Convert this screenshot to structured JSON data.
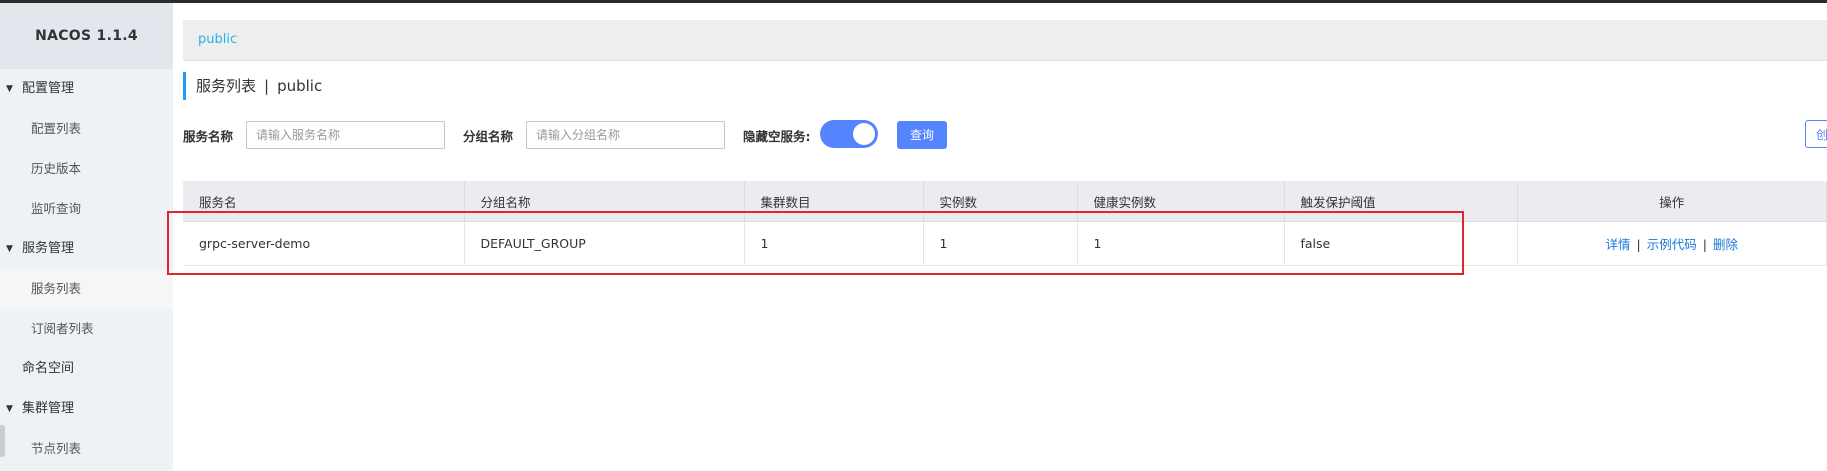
{
  "app": {
    "title": "NACOS 1.1.4"
  },
  "sidebar": {
    "items": [
      {
        "label": "配置管理",
        "type": "group"
      },
      {
        "label": "配置列表",
        "type": "sub"
      },
      {
        "label": "历史版本",
        "type": "sub"
      },
      {
        "label": "监听查询",
        "type": "sub"
      },
      {
        "label": "服务管理",
        "type": "group"
      },
      {
        "label": "服务列表",
        "type": "sub",
        "active": true
      },
      {
        "label": "订阅者列表",
        "type": "sub"
      },
      {
        "label": "命名空间",
        "type": "single"
      },
      {
        "label": "集群管理",
        "type": "group"
      },
      {
        "label": "节点列表",
        "type": "sub"
      }
    ]
  },
  "namespace": {
    "current": "public"
  },
  "page": {
    "title": "服务列表",
    "separator": "|",
    "namespace": "public"
  },
  "search": {
    "service_label": "服务名称",
    "service_placeholder": "请输入服务名称",
    "group_label": "分组名称",
    "group_placeholder": "请输入分组名称",
    "hide_empty_label": "隐藏空服务:",
    "hide_empty_on": true,
    "query_button": "查询",
    "create_button": "创"
  },
  "table": {
    "headers": [
      "服务名",
      "分组名称",
      "集群数目",
      "实例数",
      "健康实例数",
      "触发保护阈值",
      "操作"
    ],
    "rows": [
      {
        "service": "grpc-server-demo",
        "group": "DEFAULT_GROUP",
        "clusters": "1",
        "instances": "1",
        "healthy": "1",
        "threshold": "false",
        "actions": [
          "详情",
          "示例代码",
          "删除"
        ]
      }
    ],
    "action_separator": "|"
  },
  "colors": {
    "accent": "#5584ff",
    "link": "#1877d6",
    "namespace_link": "#2ab0e8",
    "highlight": "#e0252b"
  }
}
